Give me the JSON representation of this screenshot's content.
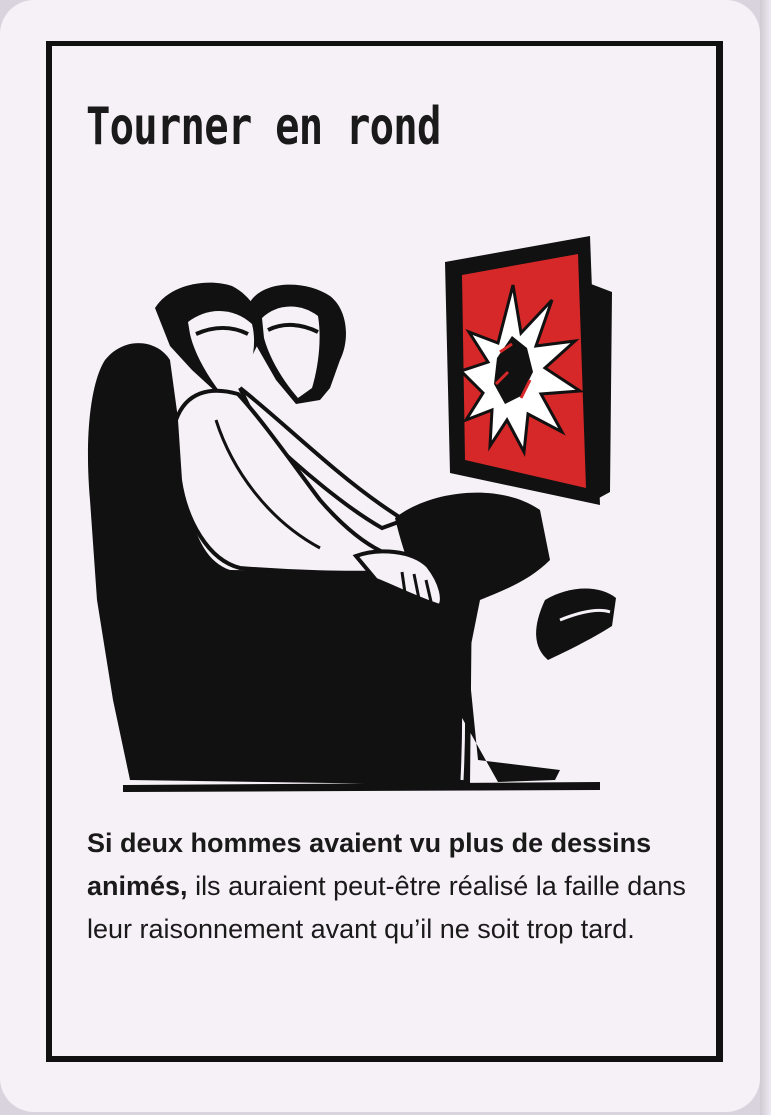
{
  "card": {
    "title": "Tourner en rond",
    "body_bold": "Si deux hommes avaient vu plus de dessins animés,",
    "body_regular": " ils auraient peut-être réalisé la faille dans leur raisonnement avant qu’il ne soit trop tard."
  },
  "illustration": {
    "subject": "two-men-in-armchair-watching-tv",
    "tv_screen_color": "#d62828",
    "ink_color": "#111111"
  }
}
